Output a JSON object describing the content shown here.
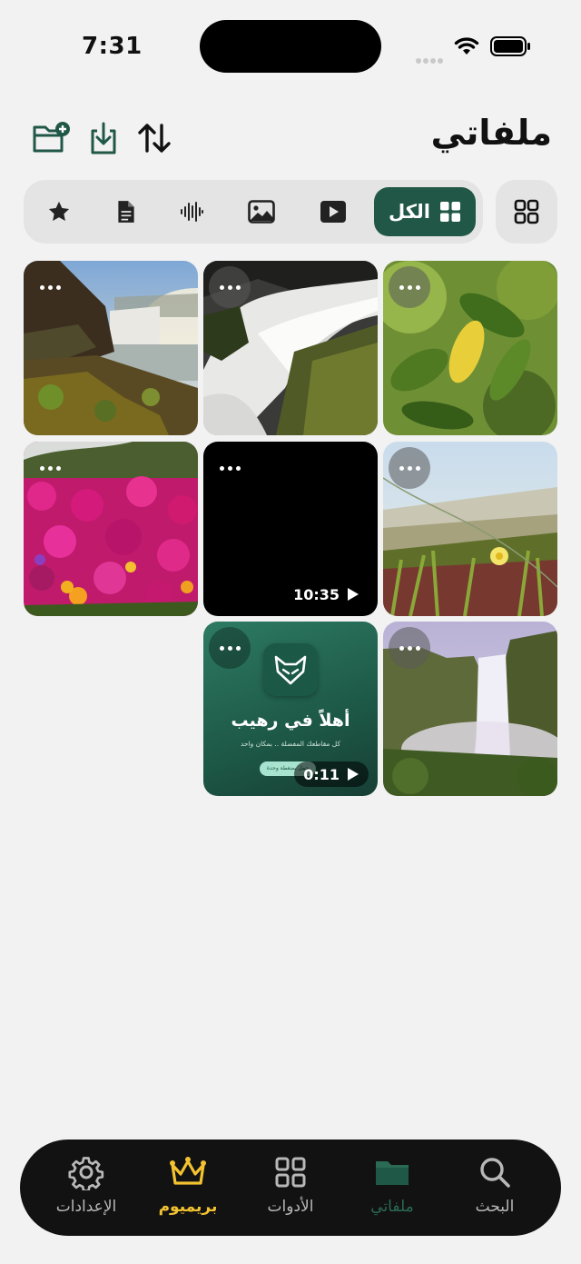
{
  "status": {
    "time": "7:31"
  },
  "header": {
    "title": "ملفاتي"
  },
  "filters": {
    "all_label": "الكل"
  },
  "tiles": [
    {
      "type": "image",
      "name": "waterfall-sunset"
    },
    {
      "type": "image",
      "name": "waterfall-bw"
    },
    {
      "type": "image",
      "name": "lemon-leaves"
    },
    {
      "type": "image",
      "name": "pink-flowers"
    },
    {
      "type": "video",
      "duration": "10:35"
    },
    {
      "type": "image",
      "name": "beach-grass"
    },
    {
      "type": "video",
      "duration": "0:11",
      "headline": "أهلاً في رهيب",
      "subtitle": "كل مقاطعك المفضلة .. بمكان واحد",
      "pill": "حمل بضغطة وحدة"
    },
    {
      "type": "image",
      "name": "misty-waterfall"
    }
  ],
  "tabbar": {
    "items": [
      {
        "label": "الإعدادات",
        "icon": "gear-icon",
        "color": "#b8b8b8"
      },
      {
        "label": "بريميوم",
        "icon": "crown-icon",
        "color": "#f2c230"
      },
      {
        "label": "الأدوات",
        "icon": "grid-icon",
        "color": "#b8b8b8"
      },
      {
        "label": "ملفاتي",
        "icon": "folder-icon",
        "color": "#2b6a55"
      },
      {
        "label": "البحث",
        "icon": "search-icon",
        "color": "#b8b8b8"
      }
    ]
  },
  "colors": {
    "accent": "#215746",
    "premium": "#f2c230",
    "background": "#f2f2f2"
  }
}
